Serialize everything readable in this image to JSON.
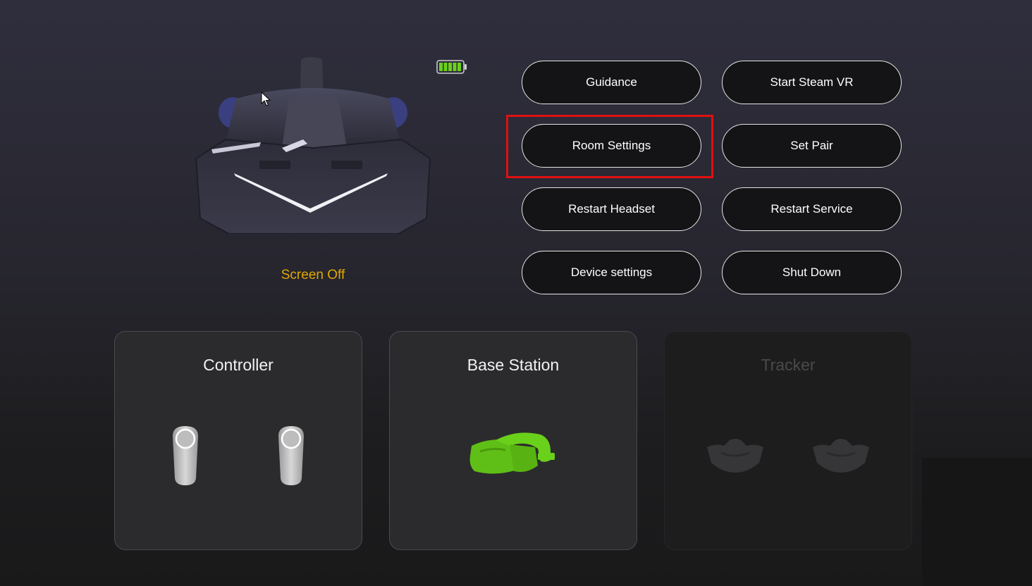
{
  "headset": {
    "status": "Screen Off",
    "image_icon": "vr-headset-icon",
    "battery_icon": "battery-full-icon",
    "battery_level": 1.0
  },
  "actions": {
    "guidance": "Guidance",
    "start_steam_vr": "Start Steam VR",
    "room_settings": "Room Settings",
    "set_pair": "Set Pair",
    "restart_headset": "Restart Headset",
    "restart_service": "Restart Service",
    "device_settings": "Device settings",
    "shut_down": "Shut Down"
  },
  "devices": {
    "controller": {
      "title": "Controller",
      "icon": "controller-icon",
      "state": "connected"
    },
    "base_station": {
      "title": "Base Station",
      "icon": "base-station-icon",
      "state": "connected"
    },
    "tracker": {
      "title": "Tracker",
      "icon": "tracker-icon",
      "state": "disabled"
    }
  },
  "colors": {
    "status_text": "#e0a800",
    "accent_green": "#66cc11",
    "highlight_red": "#e01010"
  }
}
